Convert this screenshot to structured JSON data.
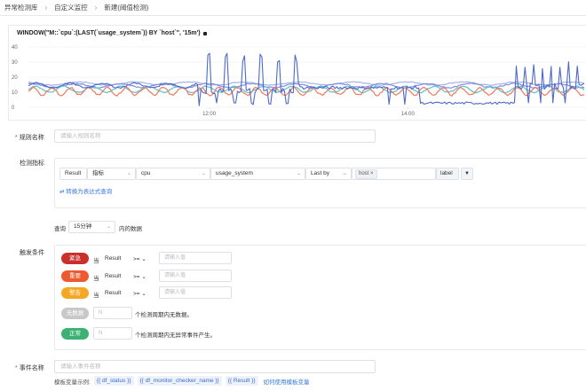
{
  "breadcrumb": {
    "items": [
      "异常检测库",
      "自定义监控",
      "新建(阈值检测)"
    ]
  },
  "chart_data": {
    "type": "line",
    "title": "WINDOW(\"M::`cpu`:(LAST(`usage_system`)) BY `host`\", '15m')",
    "y_ticks": [
      "40",
      "30",
      "20",
      "10",
      "0"
    ],
    "x_ticks": [
      "12:00",
      "14:00"
    ],
    "ylim": [
      0,
      40
    ],
    "xlim": [
      0,
      640
    ],
    "x_tick_positions": [
      208,
      436
    ],
    "series": [
      {
        "color": "#4f68c9",
        "style": "spiky-blue"
      },
      {
        "color": "#5ec2c8",
        "style": "teal-wave"
      },
      {
        "color": "#f07a5a",
        "style": "orange-zigzag"
      },
      {
        "color": "#7e8fe0",
        "style": "light-blue"
      },
      {
        "color": "#a6b2e6",
        "style": "pale"
      }
    ]
  },
  "rule_name": {
    "label": "规则名称",
    "placeholder": "请输入规则名称"
  },
  "metric": {
    "label": "检测指标",
    "result_label": "Result",
    "metric_type": "指标",
    "measurement": "cpu",
    "field": "usage_system",
    "aggregation": "Last by",
    "tag_value": "host",
    "tag_close": "×",
    "label_tag": "label",
    "filter_icon": "▼",
    "switch_link": "⇄ 转换为表达式查询",
    "range_prefix": "查询",
    "range_value": "15分钟",
    "range_suffix": "内的数据"
  },
  "trigger": {
    "label": "触发条件",
    "conditions": [
      {
        "level": "紧急",
        "color": "#c9302c",
        "when": "当",
        "field": "Result",
        "op": ">=",
        "placeholder": "请输入值"
      },
      {
        "level": "重要",
        "color": "#ee5a2f",
        "when": "当",
        "field": "Result",
        "op": ">=",
        "placeholder": "请输入值"
      },
      {
        "level": "警告",
        "color": "#f5a623",
        "when": "当",
        "field": "Result",
        "op": ">=",
        "placeholder": "请输入值"
      }
    ],
    "nodata": {
      "level": "无数据",
      "color": "#c8c8c8",
      "value": "N",
      "text": "个检测周期内无数据。"
    },
    "normal": {
      "level": "正常",
      "color": "#3bb273",
      "value": "N",
      "text": "个检测周期内无异常事件产生。"
    }
  },
  "event_name": {
    "label": "事件名称",
    "placeholder": "请输入事件名称",
    "template_label": "模板变量示例:",
    "template_vars": [
      "{{ df_status }}",
      "{{ df_monitor_checker_name }}",
      "{{ Result }}"
    ],
    "template_link": "如何使用模板变量"
  }
}
